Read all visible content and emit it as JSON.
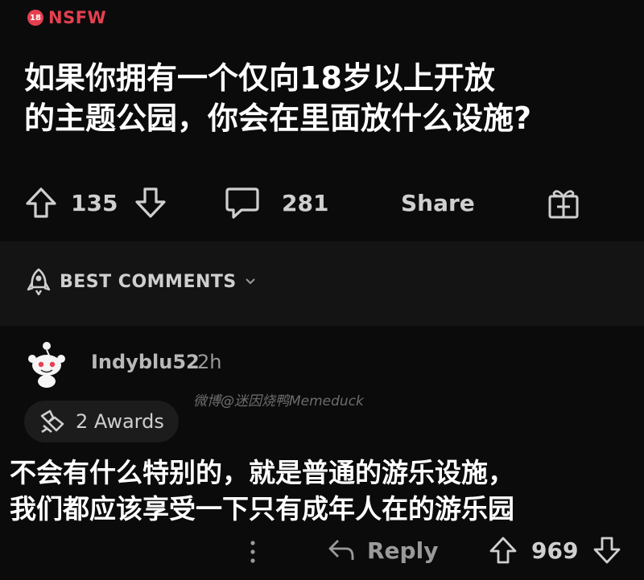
{
  "post": {
    "nsfw_badge": "18",
    "nsfw_label": "NSFW",
    "title_line1": "如果你拥有一个仅向18岁以上开放",
    "title_line2": "的主题公园，你会在里面放什么设施?",
    "upvotes": "135",
    "comments": "281",
    "share_label": "Share"
  },
  "comments_section": {
    "sort_label": "BEST COMMENTS"
  },
  "comment": {
    "username": "Indyblu52",
    "time": "2h",
    "watermark": "微博@迷因烧鸭Memeduck",
    "awards": "2 Awards",
    "body_line1": "不会有什么特别的，就是普通的游乐设施，",
    "body_line2": "我们都应该享受一下只有成年人在的游乐园",
    "reply_label": "Reply",
    "score": "969"
  },
  "colors": {
    "background": "#0b0b0c",
    "section": "#141415",
    "nsfw": "#e5404f",
    "text": "#ffffff"
  }
}
